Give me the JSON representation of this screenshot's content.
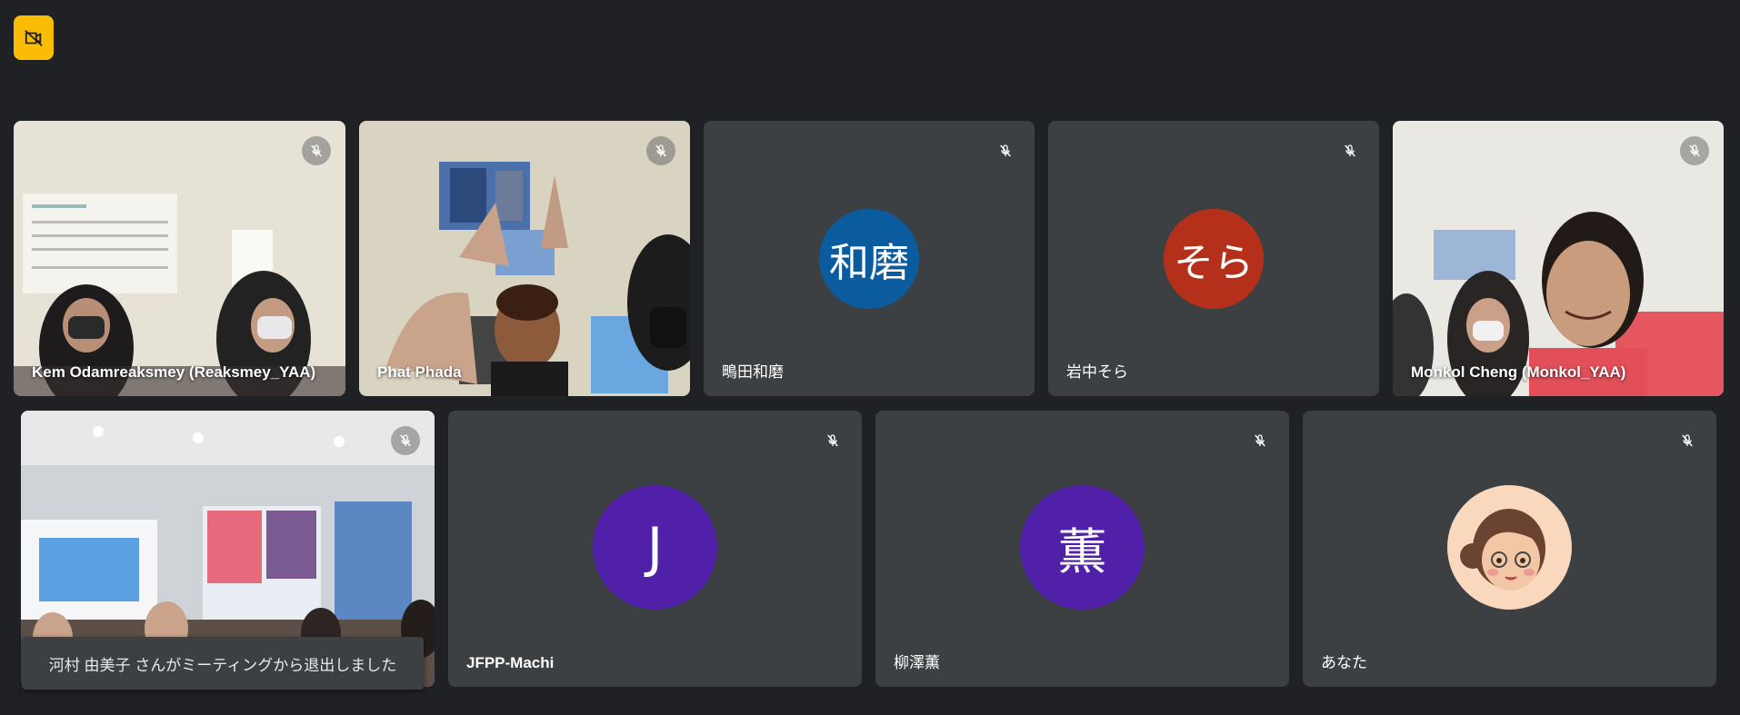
{
  "participants": [
    {
      "name": "Kem Odamreaksmey (Reaksmey_YAA)",
      "type": "video",
      "muted": true
    },
    {
      "name": "Phat Phada",
      "type": "video",
      "muted": true
    },
    {
      "name": "鴫田和磨",
      "type": "avatar",
      "initials": "和磨",
      "color": "#0b5c9e",
      "muted": true
    },
    {
      "name": "岩中そら",
      "type": "avatar",
      "initials": "そら",
      "color": "#b5301a",
      "muted": true
    },
    {
      "name": "Monkol Cheng (Monkol_YAA)",
      "type": "video",
      "muted": true
    },
    {
      "name": "",
      "type": "video",
      "muted": true
    },
    {
      "name": "JFPP-Machi",
      "type": "avatar",
      "initials": "J",
      "color": "#5021a8",
      "muted": true
    },
    {
      "name": "柳澤薫",
      "type": "avatar",
      "initials": "薫",
      "color": "#5021a8",
      "muted": true
    },
    {
      "name": "あなた",
      "type": "avatar-illustration",
      "color": "#fad8be",
      "muted": true
    }
  ],
  "notification": {
    "text": "河村 由美子 さんがミーティングから退出しました"
  },
  "colors": {
    "background": "#202124",
    "tile": "#3c4043",
    "top_button": "#fbbc04"
  },
  "icons": {
    "top_button": "camera-off-icon",
    "mic": "mic-off-icon"
  }
}
